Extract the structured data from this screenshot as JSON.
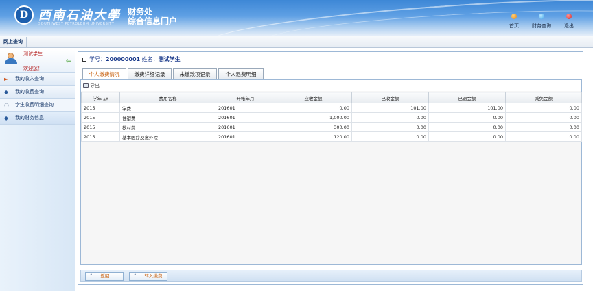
{
  "header": {
    "logo_glyph": "D",
    "university_name": "西南石油大學",
    "university_en": "SOUTHWEST PETROLEUM UNIVERSITY",
    "portal_line1": "财务处",
    "portal_line2": "综合信息门户",
    "nav": [
      {
        "label": "首页",
        "icon": "home-icon",
        "color": "#e0861c"
      },
      {
        "label": "财务查询",
        "icon": "query-icon",
        "color": "#3fa6e8"
      },
      {
        "label": "退出",
        "icon": "exit-icon",
        "color": "#d62424"
      }
    ]
  },
  "strip": {
    "tab_label": "网上查询"
  },
  "sidebar": {
    "user_name": "测试学生",
    "welcome": "欢迎您！",
    "items": [
      {
        "label": "我的收入查询",
        "icon": "arrow-right-icon",
        "icon_color": "#d0571f"
      },
      {
        "label": "我的收费查询",
        "icon": "diamond-icon",
        "icon_color": "#2a5a9a"
      },
      {
        "label": "学生收费明细查询",
        "icon": "dot-icon",
        "icon_color": "#8a9ab0"
      },
      {
        "label": "我的财务信息",
        "icon": "diamond-icon",
        "icon_color": "#2a5a9a"
      }
    ]
  },
  "student": {
    "id_label": "学号：",
    "id_value": "200000001",
    "name_label": " 姓名：",
    "name_value": "测试学生"
  },
  "tabs": [
    {
      "label": "个人缴费情况",
      "active": true
    },
    {
      "label": "缴费详细记录",
      "active": false
    },
    {
      "label": "未缴款项记录",
      "active": false
    },
    {
      "label": "个人退费明细",
      "active": false
    }
  ],
  "toolbar": {
    "export_label": "导出"
  },
  "table": {
    "columns": [
      "学年",
      "费用名称",
      "开帐年月",
      "应收金额",
      "已收金额",
      "已退金额",
      "减免金额"
    ],
    "rows": [
      [
        "2015",
        "学费",
        "201601",
        "0.00",
        "101.00",
        "101.00",
        "0.00"
      ],
      [
        "2015",
        "住宿费",
        "201601",
        "1,000.00",
        "0.00",
        "0.00",
        "0.00"
      ],
      [
        "2015",
        "教材费",
        "201601",
        "300.00",
        "0.00",
        "0.00",
        "0.00"
      ],
      [
        "2015",
        "基本医疗及意外险",
        "201601",
        "120.00",
        "0.00",
        "0.00",
        "0.00"
      ]
    ]
  },
  "footer": {
    "back_label": "返回",
    "transfer_label": "转入缴费"
  }
}
